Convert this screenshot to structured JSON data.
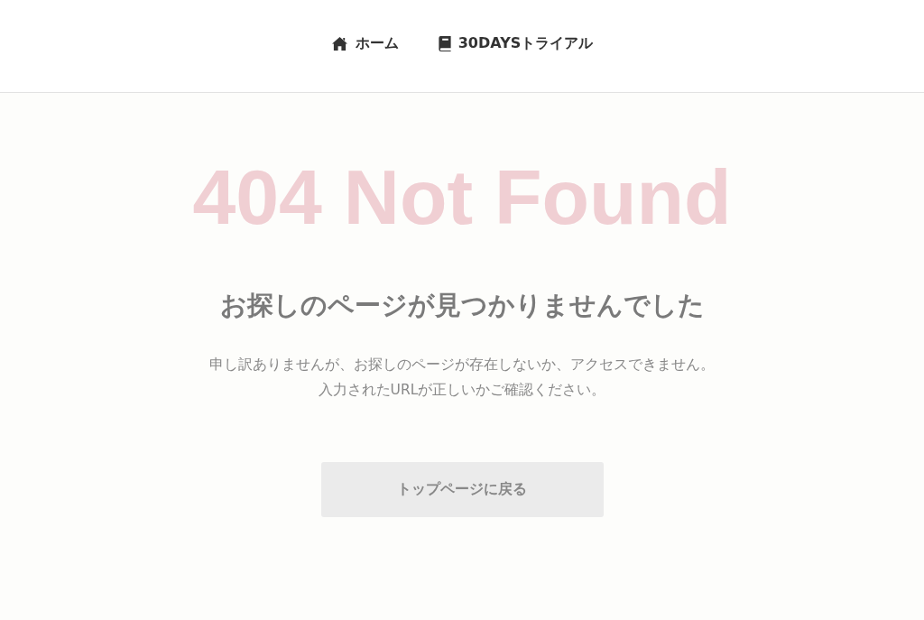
{
  "nav": [
    {
      "kind": "home",
      "label": "ホーム"
    },
    {
      "kind": "book",
      "label": "30DAYSトライアル"
    }
  ],
  "error_title": "404 Not Found",
  "heading": "お探しのページが見つかりませんでした",
  "message_lines": [
    "申し訳ありませんが、お探しのページが存在しないか、アクセスできません。",
    "入力されたURLが正しいかご確認ください。"
  ],
  "button": "トップページに戻る"
}
